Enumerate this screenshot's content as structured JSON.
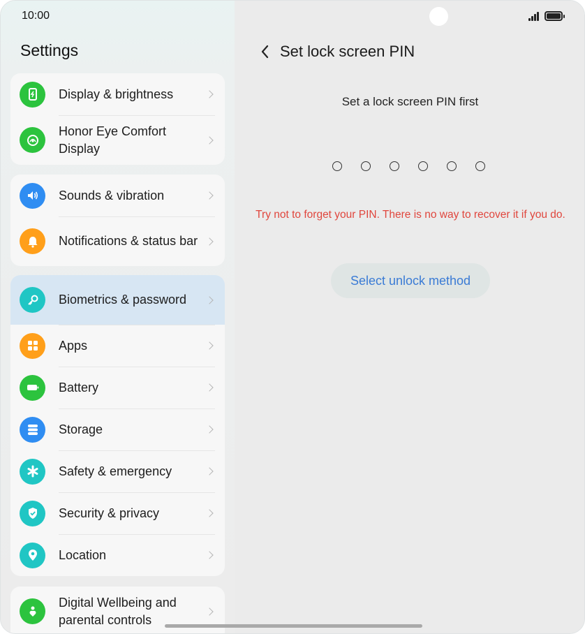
{
  "status_bar": {
    "time": "10:00"
  },
  "sidebar": {
    "title": "Settings",
    "groups": [
      {
        "items": [
          {
            "label": "Display & brightness",
            "icon": "display-brightness-icon",
            "color": "#2cc33e"
          },
          {
            "label": "Honor Eye Comfort Display",
            "icon": "eye-comfort-icon",
            "color": "#2cc33e"
          }
        ]
      },
      {
        "items": [
          {
            "label": "Sounds & vibration",
            "icon": "speaker-icon",
            "color": "#2f8df2"
          },
          {
            "label": "Notifications & status bar",
            "icon": "bell-icon",
            "color": "#ff9f1a"
          }
        ]
      },
      {
        "items": [
          {
            "label": "Biometrics & password",
            "icon": "key-icon",
            "color": "#20c6c4",
            "selected": true
          },
          {
            "label": "Apps",
            "icon": "apps-grid-icon",
            "color": "#ff9f1a"
          },
          {
            "label": "Battery",
            "icon": "battery-icon",
            "color": "#2cc33e"
          },
          {
            "label": "Storage",
            "icon": "storage-icon",
            "color": "#2f8df2"
          },
          {
            "label": "Safety & emergency",
            "icon": "asterisk-icon",
            "color": "#20c6c4"
          },
          {
            "label": "Security & privacy",
            "icon": "shield-check-icon",
            "color": "#20c6c4"
          },
          {
            "label": "Location",
            "icon": "location-pin-icon",
            "color": "#20c6c4"
          }
        ]
      },
      {
        "items": [
          {
            "label": "Digital Wellbeing and parental controls",
            "icon": "wellbeing-icon",
            "color": "#2cc33e"
          }
        ]
      }
    ]
  },
  "main": {
    "title": "Set lock screen PIN",
    "subtitle": "Set a lock screen PIN first",
    "pin_length": 6,
    "warning": "Try not to forget your PIN. There is no way to recover it if you do.",
    "unlock_button": "Select unlock method"
  },
  "colors": {
    "accent": "#3a7bd5",
    "warning": "#e0463d",
    "selected_row": "#d7e6f3"
  }
}
